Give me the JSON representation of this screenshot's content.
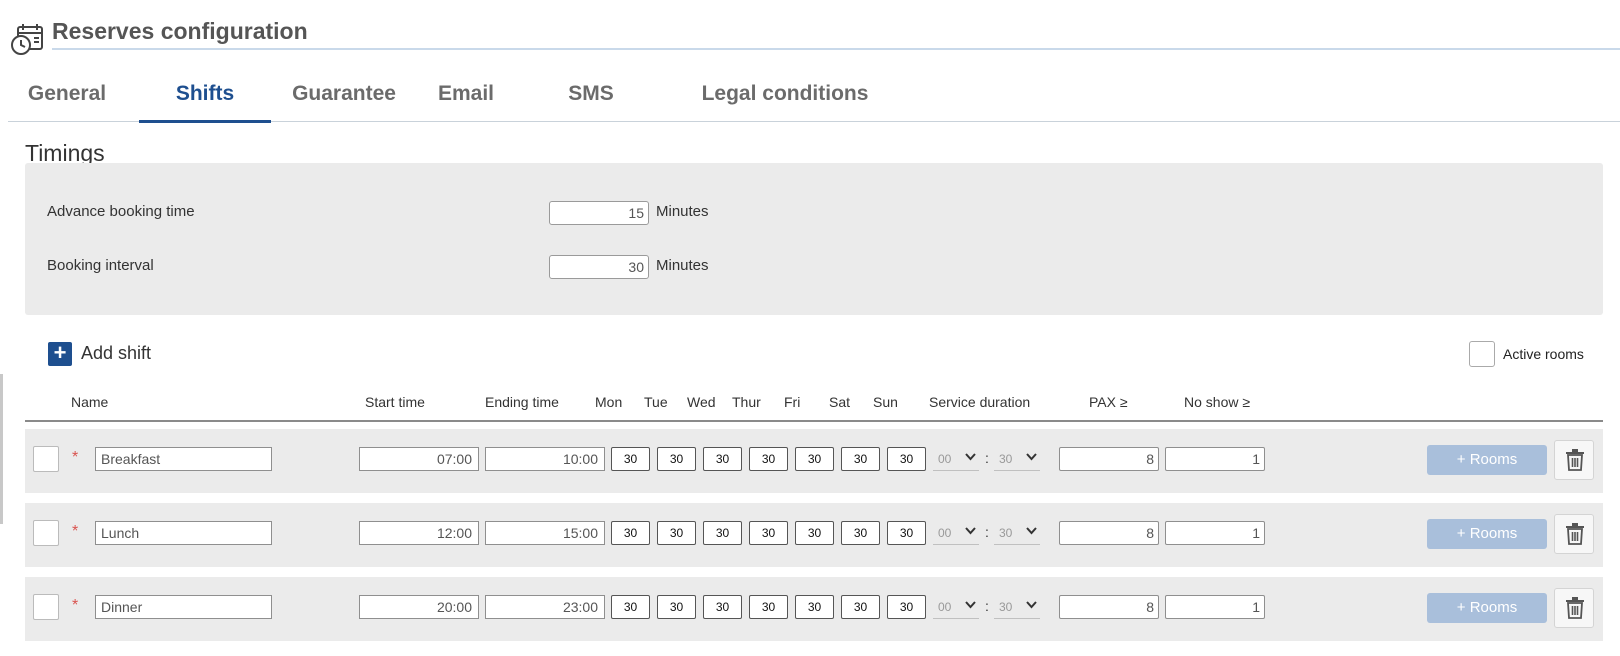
{
  "header": {
    "title": "Reserves configuration",
    "icon": "calendar-clock-icon"
  },
  "tabs": [
    {
      "label": "General",
      "active": false
    },
    {
      "label": "Shifts",
      "active": true
    },
    {
      "label": "Guarantee",
      "active": false
    },
    {
      "label": "Email",
      "active": false
    },
    {
      "label": "SMS",
      "active": false
    },
    {
      "label": "Legal conditions",
      "active": false
    }
  ],
  "timings": {
    "title": "Timings",
    "advance_booking": {
      "label": "Advance booking time",
      "value": "15",
      "unit": "Minutes"
    },
    "booking_interval": {
      "label": "Booking interval",
      "value": "30",
      "unit": "Minutes"
    }
  },
  "shifts_toolbar": {
    "add_shift_label": "Add shift",
    "active_rooms_label": "Active rooms",
    "active_rooms_checked": false
  },
  "columns": {
    "name": "Name",
    "start_time": "Start time",
    "ending_time": "Ending time",
    "mon": "Mon",
    "tue": "Tue",
    "wed": "Wed",
    "thur": "Thur",
    "fri": "Fri",
    "sat": "Sat",
    "sun": "Sun",
    "service_duration": "Service duration",
    "pax": "PAX ≥",
    "no_show": "No show ≥"
  },
  "shifts": [
    {
      "name": "Breakfast",
      "start": "07:00",
      "end": "10:00",
      "days": [
        "30",
        "30",
        "30",
        "30",
        "30",
        "30",
        "30"
      ],
      "dur_hours": "00",
      "dur_minutes": "30",
      "pax": "8",
      "no_show": "1",
      "rooms_label": "+ Rooms"
    },
    {
      "name": "Lunch",
      "start": "12:00",
      "end": "15:00",
      "days": [
        "30",
        "30",
        "30",
        "30",
        "30",
        "30",
        "30"
      ],
      "dur_hours": "00",
      "dur_minutes": "30",
      "pax": "8",
      "no_show": "1",
      "rooms_label": "+ Rooms"
    },
    {
      "name": "Dinner",
      "start": "20:00",
      "end": "23:00",
      "days": [
        "30",
        "30",
        "30",
        "30",
        "30",
        "30",
        "30"
      ],
      "dur_hours": "00",
      "dur_minutes": "30",
      "pax": "8",
      "no_show": "1",
      "rooms_label": "+ Rooms"
    }
  ],
  "colors": {
    "accent": "#1e4f8f",
    "rooms_button": "#a9bfdb",
    "panel": "#ebebeb",
    "required": "#d9534f"
  }
}
